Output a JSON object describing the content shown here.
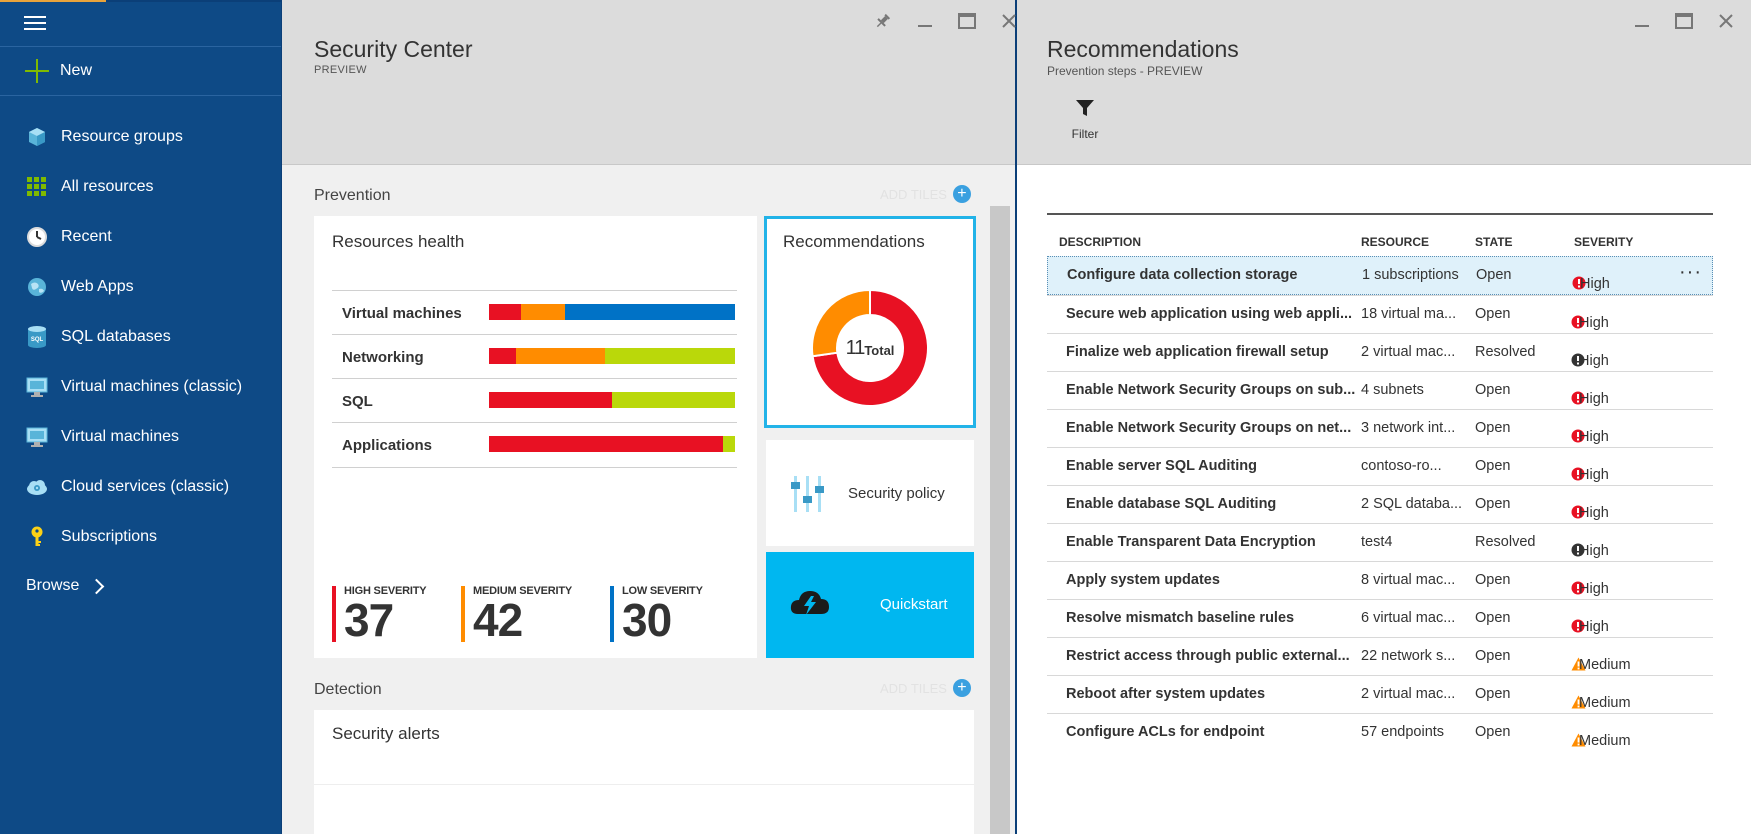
{
  "sidebar": {
    "new_label": "New",
    "items": [
      {
        "label": "Resource groups",
        "icon": "cube-icon"
      },
      {
        "label": "All resources",
        "icon": "grid-icon"
      },
      {
        "label": "Recent",
        "icon": "clock-icon"
      },
      {
        "label": "Web Apps",
        "icon": "globe-icon"
      },
      {
        "label": "SQL databases",
        "icon": "sql-database-icon"
      },
      {
        "label": "Virtual machines (classic)",
        "icon": "monitor-icon"
      },
      {
        "label": "Virtual machines",
        "icon": "monitor-icon"
      },
      {
        "label": "Cloud services (classic)",
        "icon": "cloud-gear-icon"
      },
      {
        "label": "Subscriptions",
        "icon": "key-icon"
      }
    ],
    "browse_label": "Browse"
  },
  "security_center": {
    "title": "Security Center",
    "subtitle": "PREVIEW",
    "prevention_label": "Prevention",
    "add_tiles_label": "ADD TILES",
    "detection_label": "Detection",
    "resources_health": {
      "title": "Resources health",
      "rows": [
        {
          "name": "Virtual machines",
          "segments": [
            {
              "color": "#e81123",
              "value": 13
            },
            {
              "color": "#ff8c00",
              "value": 18
            },
            {
              "color": "#0072c6",
              "value": 69
            }
          ]
        },
        {
          "name": "Networking",
          "segments": [
            {
              "color": "#e81123",
              "value": 11
            },
            {
              "color": "#ff8c00",
              "value": 36
            },
            {
              "color": "#bad80a",
              "value": 53
            }
          ]
        },
        {
          "name": "SQL",
          "segments": [
            {
              "color": "#e81123",
              "value": 50
            },
            {
              "color": "#bad80a",
              "value": 50
            }
          ]
        },
        {
          "name": "Applications",
          "segments": [
            {
              "color": "#e81123",
              "value": 95
            },
            {
              "color": "#bad80a",
              "value": 5
            }
          ]
        }
      ],
      "severities": [
        {
          "label": "HIGH SEVERITY",
          "value": "37",
          "color": "#e81123"
        },
        {
          "label": "MEDIUM SEVERITY",
          "value": "42",
          "color": "#ff8c00"
        },
        {
          "label": "LOW SEVERITY",
          "value": "30",
          "color": "#0072c6"
        }
      ]
    },
    "recommendations_tile": {
      "title": "Recommendations",
      "total_number": "11",
      "total_label": "Total",
      "donut": [
        {
          "color": "#e81123",
          "value": 8
        },
        {
          "color": "#ff8c00",
          "value": 3
        }
      ]
    },
    "security_policy_label": "Security policy",
    "quickstart_label": "Quickstart",
    "security_alerts_title": "Security alerts"
  },
  "recommendations": {
    "title": "Recommendations",
    "subtitle": "Prevention steps - PREVIEW",
    "filter_label": "Filter",
    "columns": [
      "DESCRIPTION",
      "RESOURCE",
      "STATE",
      "SEVERITY"
    ],
    "rows": [
      {
        "description": "Configure data collection storage",
        "resource": "1 subscriptions",
        "state": "Open",
        "severity": "High",
        "icon": "red-alert-icon",
        "selected": true
      },
      {
        "description": "Secure web application using web appli...",
        "resource": "18 virtual ma...",
        "state": "Open",
        "severity": "High",
        "icon": "red-alert-icon"
      },
      {
        "description": "Finalize web application firewall setup",
        "resource": "2 virtual mac...",
        "state": "Resolved",
        "severity": "High",
        "icon": "black-alert-icon"
      },
      {
        "description": "Enable Network Security Groups on sub...",
        "resource": "4 subnets",
        "state": "Open",
        "severity": "High",
        "icon": "red-alert-icon"
      },
      {
        "description": "Enable Network Security Groups on net...",
        "resource": "3 network int...",
        "state": "Open",
        "severity": "High",
        "icon": "red-alert-icon"
      },
      {
        "description": "Enable server SQL Auditing",
        "resource": "contoso-ro...",
        "state": "Open",
        "severity": "High",
        "icon": "red-alert-icon"
      },
      {
        "description": "Enable database SQL Auditing",
        "resource": "2 SQL databa...",
        "state": "Open",
        "severity": "High",
        "icon": "red-alert-icon"
      },
      {
        "description": "Enable Transparent Data Encryption",
        "resource": "test4",
        "state": "Resolved",
        "severity": "High",
        "icon": "black-alert-icon"
      },
      {
        "description": "Apply system updates",
        "resource": "8 virtual mac...",
        "state": "Open",
        "severity": "High",
        "icon": "red-alert-icon"
      },
      {
        "description": "Resolve mismatch baseline rules",
        "resource": "6 virtual mac...",
        "state": "Open",
        "severity": "High",
        "icon": "red-alert-icon"
      },
      {
        "description": "Restrict access through public external...",
        "resource": "22 network s...",
        "state": "Open",
        "severity": "Medium",
        "icon": "warning-triangle-icon"
      },
      {
        "description": "Reboot after system updates",
        "resource": "2 virtual mac...",
        "state": "Open",
        "severity": "Medium",
        "icon": "warning-triangle-icon"
      },
      {
        "description": "Configure ACLs for endpoint",
        "resource": "57 endpoints",
        "state": "Open",
        "severity": "Medium",
        "icon": "warning-triangle-icon"
      }
    ],
    "more_label": "···"
  }
}
